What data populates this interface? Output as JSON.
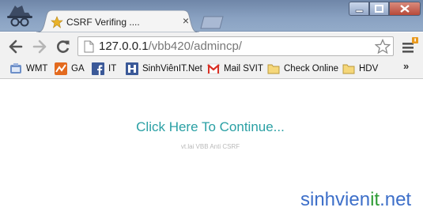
{
  "window": {
    "tab": {
      "title": "CSRF Verifing ....",
      "close_glyph": "×"
    }
  },
  "toolbar": {
    "url_host": "127.0.0.1",
    "url_path": "/vbb420/admincp/"
  },
  "bookmarks": {
    "items": [
      {
        "label": "WMT",
        "icon": "webmaster-tools-icon"
      },
      {
        "label": "GA",
        "icon": "analytics-icon"
      },
      {
        "label": "IT",
        "icon": "facebook-icon"
      },
      {
        "label": "SinhViênIT.Net",
        "icon": "hub-icon"
      },
      {
        "label": "Mail SVIT",
        "icon": "gmail-icon"
      },
      {
        "label": "Check Online",
        "icon": "folder-icon"
      },
      {
        "label": "HDV",
        "icon": "folder-icon"
      }
    ],
    "overflow_glyph": "»"
  },
  "page": {
    "link_text": "Click Here To Continue...",
    "credit_text": "vt.lai VBB Anti CSRF",
    "link_color": "#2aa0a4"
  },
  "watermark": {
    "part1": "sinhvien",
    "part2": "it",
    "part3": ".net"
  }
}
